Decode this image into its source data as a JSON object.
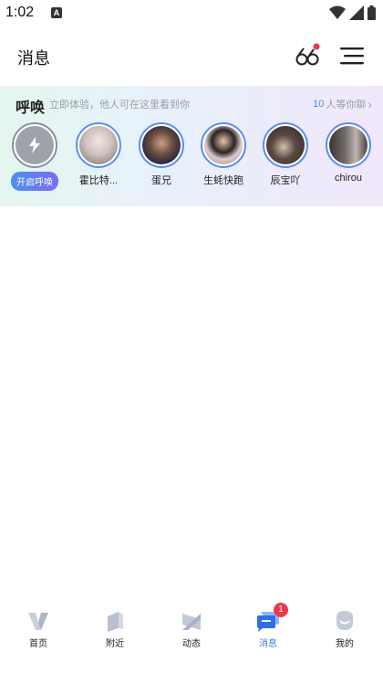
{
  "status_bar": {
    "time": "1:02",
    "notification_glyph": "A"
  },
  "header": {
    "title": "消息",
    "glasses_icon": "glasses-icon",
    "menu_icon": "menu-icon"
  },
  "huhuan": {
    "title": "呼唤",
    "subtitle": "立即体验，他人可在这里看到你",
    "waiting_count": "10",
    "waiting_text": "人等你聊",
    "chevron": "›",
    "call_button": "开启呼唤",
    "users": [
      {
        "name": "霍比特..."
      },
      {
        "name": "蛋兄"
      },
      {
        "name": "生蚝快跑"
      },
      {
        "name": "辰宝吖"
      },
      {
        "name": "chirou"
      }
    ]
  },
  "bottom_nav": {
    "items": [
      {
        "label": "首页",
        "icon": "home-icon"
      },
      {
        "label": "附近",
        "icon": "nearby-icon"
      },
      {
        "label": "动态",
        "icon": "moments-icon"
      },
      {
        "label": "消息",
        "icon": "messages-icon",
        "badge": "1",
        "active": true
      },
      {
        "label": "我的",
        "icon": "profile-icon"
      }
    ]
  },
  "colors": {
    "accent": "#3b7df0",
    "badge": "#f0364a",
    "ring": "#5b8def"
  }
}
